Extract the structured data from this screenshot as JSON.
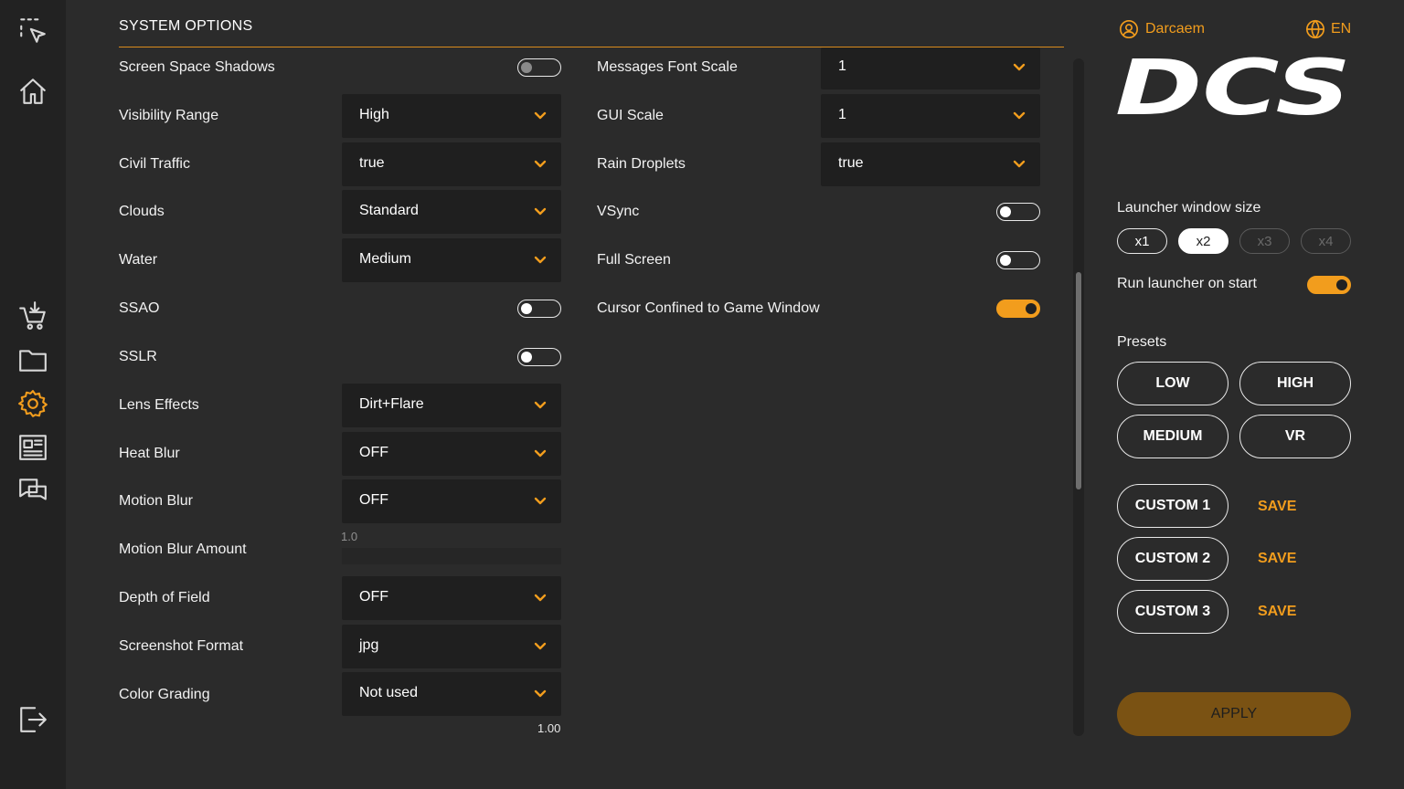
{
  "section_title": "SYSTEM OPTIONS",
  "left_column": [
    {
      "label": "Screen Space Shadows",
      "type": "toggle",
      "on": false
    },
    {
      "label": "Visibility Range",
      "type": "dropdown",
      "value": "High"
    },
    {
      "label": "Civil Traffic",
      "type": "dropdown",
      "value": "true"
    },
    {
      "label": "Clouds",
      "type": "dropdown",
      "value": "Standard"
    },
    {
      "label": "Water",
      "type": "dropdown",
      "value": "Medium"
    },
    {
      "label": "SSAO",
      "type": "toggle",
      "on": false
    },
    {
      "label": "SSLR",
      "type": "toggle",
      "on": false
    },
    {
      "label": "Lens Effects",
      "type": "dropdown",
      "value": "Dirt+Flare"
    },
    {
      "label": "Heat Blur",
      "type": "dropdown",
      "value": "OFF"
    },
    {
      "label": "Motion Blur",
      "type": "dropdown",
      "value": "OFF"
    },
    {
      "label": "Motion Blur Amount",
      "type": "slider",
      "value": "1.0"
    },
    {
      "label": "Depth of Field",
      "type": "dropdown",
      "value": "OFF"
    },
    {
      "label": "Screenshot Format",
      "type": "dropdown",
      "value": "jpg"
    },
    {
      "label": "Color Grading",
      "type": "dropdown",
      "value": "Not used"
    }
  ],
  "left_trailing_value": "1.00",
  "right_column": [
    {
      "label": "Messages Font Scale",
      "type": "dropdown",
      "value": "1"
    },
    {
      "label": "GUI Scale",
      "type": "dropdown",
      "value": "1"
    },
    {
      "label": "Rain Droplets",
      "type": "dropdown",
      "value": "true"
    },
    {
      "label": "VSync",
      "type": "toggle",
      "on": false
    },
    {
      "label": "Full Screen",
      "type": "toggle",
      "on": false
    },
    {
      "label": "Cursor Confined to Game Window",
      "type": "toggle",
      "on": true
    }
  ],
  "user": {
    "name": "Darcaem",
    "language": "EN"
  },
  "logo_text": "DCS",
  "launcher": {
    "window_size_label": "Launcher window size",
    "sizes": [
      "x1",
      "x2",
      "x3",
      "x4"
    ],
    "selected_size": "x2",
    "run_on_start_label": "Run launcher on start",
    "run_on_start": true
  },
  "presets": {
    "label": "Presets",
    "items": [
      "LOW",
      "HIGH",
      "MEDIUM",
      "VR"
    ],
    "custom": [
      "CUSTOM 1",
      "CUSTOM 2",
      "CUSTOM 3"
    ],
    "save_label": "SAVE"
  },
  "apply_label": "APPLY",
  "colors": {
    "accent": "#f29d1d",
    "background": "#2b2b2b",
    "rail": "#222222",
    "dropdown": "#1f1f1f"
  },
  "rail_icons": [
    "select-icon",
    "home-icon",
    "download-cart-icon",
    "folder-icon",
    "settings-gear-icon",
    "news-icon",
    "chat-icon",
    "logout-icon"
  ]
}
